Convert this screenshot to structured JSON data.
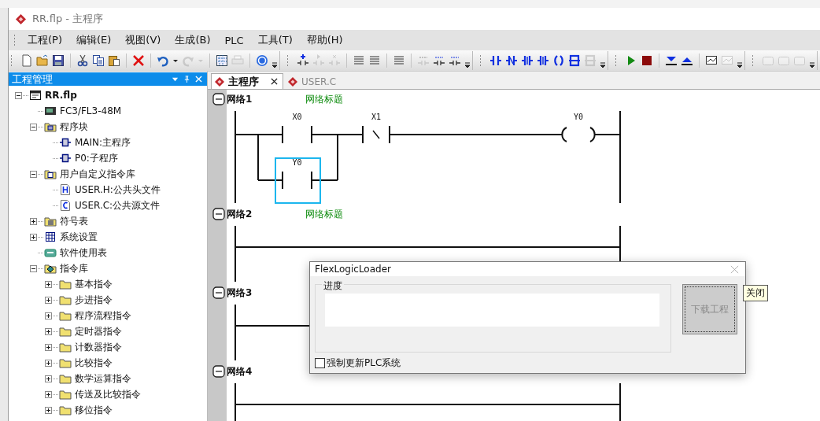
{
  "window": {
    "title": "RR.flp - 主程序"
  },
  "menu": [
    "工程(P)",
    "编辑(E)",
    "视图(V)",
    "生成(B)",
    "PLC",
    "工具(T)",
    "帮助(H)"
  ],
  "toolbar": [
    [
      {
        "kind": "new",
        "disabled": false
      },
      {
        "kind": "open",
        "disabled": false
      },
      {
        "kind": "save",
        "disabled": false
      },
      {
        "kind": "separator"
      },
      {
        "kind": "cut",
        "disabled": false
      },
      {
        "kind": "copy",
        "disabled": false
      },
      {
        "kind": "paste",
        "disabled": false
      },
      {
        "kind": "separator"
      },
      {
        "kind": "delete",
        "disabled": false
      },
      {
        "kind": "separator"
      },
      {
        "kind": "undo",
        "disabled": false
      },
      {
        "kind": "caret",
        "disabled": false
      },
      {
        "kind": "redo",
        "disabled": true
      },
      {
        "kind": "caret",
        "disabled": true
      },
      {
        "kind": "separator"
      },
      {
        "kind": "table",
        "disabled": false
      },
      {
        "kind": "print",
        "disabled": true
      },
      {
        "kind": "separator"
      },
      {
        "kind": "help",
        "disabled": false
      }
    ],
    [
      {
        "kind": "addrung",
        "disabled": false
      },
      {
        "kind": "insertrung",
        "disabled": true
      },
      {
        "kind": "delrung",
        "disabled": true
      },
      {
        "kind": "separator"
      },
      {
        "kind": "lines",
        "disabled": false
      },
      {
        "kind": "lines",
        "disabled": false
      },
      {
        "kind": "separator"
      },
      {
        "kind": "lines",
        "disabled": false
      },
      {
        "kind": "separator"
      },
      {
        "kind": "comment",
        "disabled": true
      },
      {
        "kind": "comment",
        "disabled": false
      },
      {
        "kind": "comment",
        "disabled": false
      }
    ],
    [
      {
        "kind": "nocontact",
        "disabled": false
      },
      {
        "kind": "nccontact",
        "disabled": false
      },
      {
        "kind": "pcontact",
        "disabled": false
      },
      {
        "kind": "ncontact",
        "disabled": false
      },
      {
        "kind": "coil",
        "disabled": false
      },
      {
        "kind": "block",
        "disabled": false
      },
      {
        "kind": "block",
        "disabled": true
      }
    ],
    [
      {
        "kind": "run",
        "disabled": false
      },
      {
        "kind": "stop",
        "disabled": false
      },
      {
        "kind": "separator"
      },
      {
        "kind": "download",
        "disabled": false
      },
      {
        "kind": "upload",
        "disabled": false
      },
      {
        "kind": "separator"
      },
      {
        "kind": "monitor",
        "disabled": false
      },
      {
        "kind": "monitor",
        "disabled": true
      }
    ],
    [
      {
        "kind": "frame",
        "disabled": true
      },
      {
        "kind": "frame",
        "disabled": true
      },
      {
        "kind": "frame",
        "disabled": true
      }
    ]
  ],
  "project_panel": {
    "title": "工程管理",
    "tree": [
      {
        "label": "RR.flp",
        "kind": "project",
        "expanded": true,
        "children": [
          {
            "label": "FC3/FL3-48M",
            "kind": "plc"
          },
          {
            "label": "程序块",
            "kind": "blocks",
            "expanded": true,
            "children": [
              {
                "label": "MAIN:主程序",
                "kind": "routine"
              },
              {
                "label": "P0:子程序",
                "kind": "routine"
              }
            ]
          },
          {
            "label": "用户自定义指令库",
            "kind": "library",
            "expanded": true,
            "children": [
              {
                "label": "USER.H:公共头文件",
                "kind": "header"
              },
              {
                "label": "USER.C:公共源文件",
                "kind": "source"
              }
            ]
          },
          {
            "label": "符号表",
            "kind": "symbols",
            "expanded": false
          },
          {
            "label": "系统设置",
            "kind": "settings",
            "expanded": false
          },
          {
            "label": "软件使用表",
            "kind": "usage"
          },
          {
            "label": "指令库",
            "kind": "instructions",
            "expanded": true,
            "children": [
              {
                "label": "基本指令",
                "kind": "folder",
                "expanded": false
              },
              {
                "label": "步进指令",
                "kind": "folder",
                "expanded": false
              },
              {
                "label": "程序流程指令",
                "kind": "folder",
                "expanded": false
              },
              {
                "label": "定时器指令",
                "kind": "folder",
                "expanded": false
              },
              {
                "label": "计数器指令",
                "kind": "folder",
                "expanded": false
              },
              {
                "label": "比较指令",
                "kind": "folder",
                "expanded": false
              },
              {
                "label": "数学运算指令",
                "kind": "folder",
                "expanded": false
              },
              {
                "label": "传送及比较指令",
                "kind": "folder",
                "expanded": false
              },
              {
                "label": "移位指令",
                "kind": "folder",
                "expanded": false
              }
            ]
          }
        ]
      }
    ]
  },
  "tabs": [
    {
      "label": "主程序",
      "selected": true
    },
    {
      "label": "USER.C",
      "selected": false
    }
  ],
  "networks": [
    {
      "label": "网络1",
      "title": "网络标题",
      "elements": [
        {
          "kind": "parallel",
          "branches": [
            [
              {
                "kind": "no_contact",
                "label": "X0",
                "selected": false
              }
            ],
            [
              {
                "kind": "no_contact",
                "label": "Y0",
                "selected": true
              }
            ]
          ]
        },
        {
          "kind": "nc_contact",
          "label": "X1",
          "selected": false
        },
        {
          "kind": "coil",
          "label": "Y0",
          "selected": false
        }
      ]
    },
    {
      "label": "网络2",
      "title": "网络标题"
    },
    {
      "label": "网络3"
    },
    {
      "label": "网络4"
    }
  ],
  "dialog": {
    "title": "FlexLogicLoader",
    "group_label": "进度",
    "progress": {
      "level": 0
    },
    "button": {
      "label": "下载工程",
      "disabled": true
    },
    "checkbox": {
      "label": "强制更新PLC系统",
      "checked": false
    }
  },
  "tooltip": {
    "text": "关闭"
  }
}
